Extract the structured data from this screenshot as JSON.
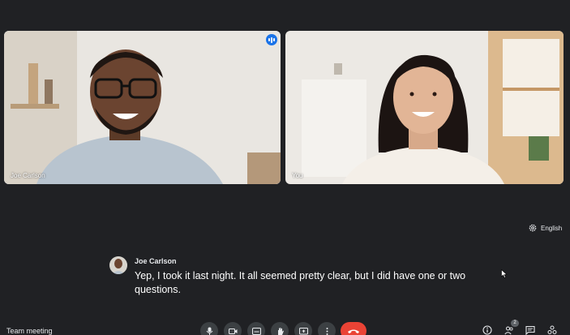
{
  "participants": [
    {
      "name": "Joe Carlson",
      "speaking": true
    },
    {
      "name": "You",
      "speaking": false
    }
  ],
  "captions": {
    "language": "English",
    "speaker": "Joe Carlson",
    "text": "Yep, I took it last night. It all seemed pretty clear, but I did have one or two questions."
  },
  "meeting": {
    "title": "Team meeting"
  },
  "controls": [
    {
      "name": "microphone-icon"
    },
    {
      "name": "camera-icon"
    },
    {
      "name": "captions-icon"
    },
    {
      "name": "raise-hand-icon"
    },
    {
      "name": "present-icon"
    },
    {
      "name": "more-options-icon"
    },
    {
      "name": "end-call-icon"
    }
  ],
  "side_controls": {
    "people_count": "2",
    "icons": [
      "info-icon",
      "people-icon",
      "chat-icon",
      "activities-icon"
    ]
  },
  "colors": {
    "background": "#202124",
    "active_outline": "#8ab4f8",
    "end_call": "#ea4335",
    "control": "#3c4043"
  }
}
